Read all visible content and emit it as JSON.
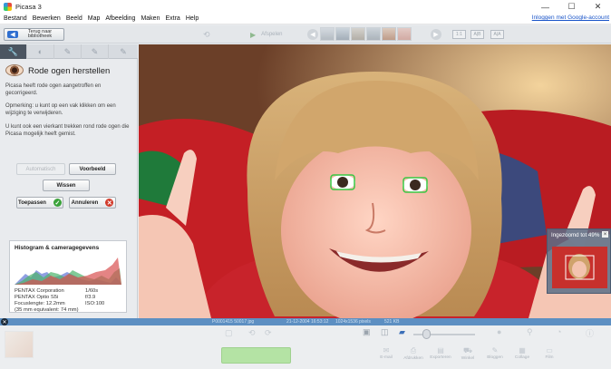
{
  "window": {
    "title": "Picasa 3",
    "minimize": "—",
    "maximize": "☐",
    "close": "✕"
  },
  "menu": [
    "Bestand",
    "Bewerken",
    "Beeld",
    "Map",
    "Afbeelding",
    "Maken",
    "Extra",
    "Help"
  ],
  "signin": "Inloggen met Google-account",
  "toolbar": {
    "back_label": "Terug naar bibliotheek",
    "play_label": "Afspelen",
    "view_buttons": [
      "1:1",
      "A|B",
      "A|A"
    ]
  },
  "panel": {
    "title": "Rode ogen herstellen",
    "paragraph1": "Picasa heeft rode ogen aangetroffen en gecorrigeerd.",
    "paragraph2": "Opmerking: u kunt op een vak klikken om een wijziging te verwijderen.",
    "paragraph3": "U kunt ook een vierkant trekken rond rode ogen die Picasa mogelijk heeft gemist.",
    "btn_auto": "Automatisch",
    "btn_preview": "Voorbeeld",
    "btn_clear": "Wissen",
    "btn_apply": "Toepassen",
    "btn_cancel": "Annuleren"
  },
  "histogram": {
    "title": "Histogram & cameragegevens",
    "rows": [
      {
        "k": "PENTAX Corporation",
        "v": "1/60s"
      },
      {
        "k": "PENTAX Optio S5i",
        "v": "f/3.9"
      },
      {
        "k": "Focuslengte: 12.2mm",
        "v": "ISO:100"
      },
      {
        "k": "(35 mm equivalent:  74 mm)",
        "v": ""
      }
    ]
  },
  "status": {
    "filename": "P0001415 50017 jpg",
    "date": "21-12-2004 16:53:12",
    "size": "1024x1536 pixels",
    "filesize": "521 KB"
  },
  "zoom": {
    "label": "Ingezoomd tot  49%",
    "close": "×",
    "level_percent": 49
  },
  "bottom": {
    "share": [
      "E-mail",
      "Afdrukken",
      "Exporteren",
      "Winkel",
      "Bloggen",
      "Collage",
      "Film"
    ]
  },
  "colors": {
    "accent": "#2f6fd0",
    "status_strip": "#5d8fc2",
    "apply_green": "#3aa23a",
    "cancel_red": "#d23b2b"
  }
}
